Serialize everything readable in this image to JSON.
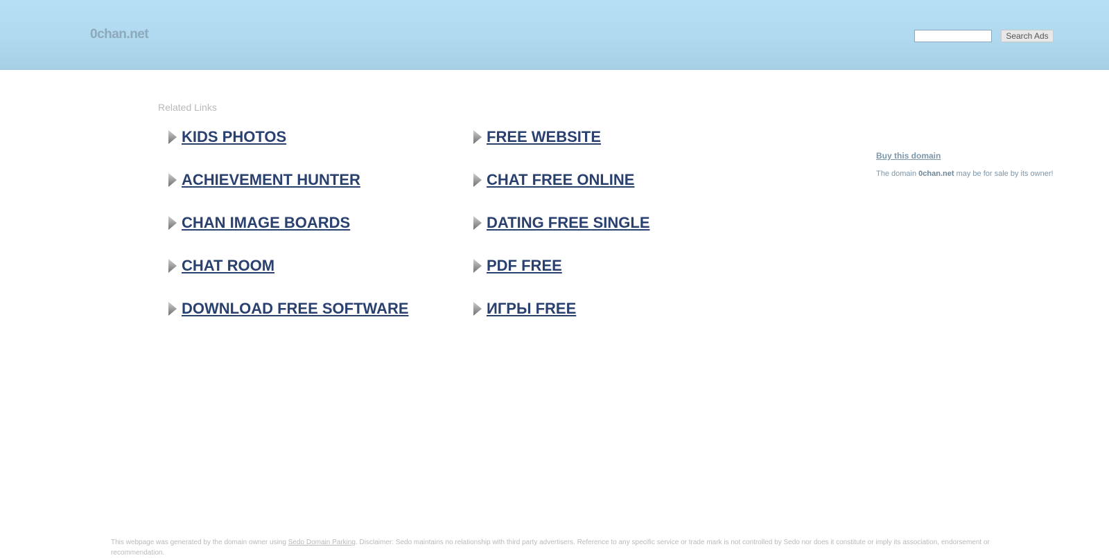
{
  "header": {
    "site_name": "0chan.net",
    "search_placeholder": "",
    "search_value": "",
    "search_button_label": "Search Ads"
  },
  "related": {
    "title": "Related Links",
    "left_column": [
      "KIDS PHOTOS",
      "ACHIEVEMENT HUNTER",
      "CHAN IMAGE BOARDS",
      "CHAT ROOM",
      "DOWNLOAD FREE SOFTWARE"
    ],
    "right_column": [
      "FREE WEBSITE",
      "CHAT FREE ONLINE",
      "DATING FREE SINGLE",
      "PDF FREE",
      "ИГРЫ FREE"
    ]
  },
  "sidebar": {
    "buy_label": "Buy this domain",
    "sale_prefix": "The domain ",
    "sale_domain": "0chan.net",
    "sale_suffix": " may be for sale by its owner!"
  },
  "footer": {
    "prefix": "This webpage was generated by the domain owner using ",
    "link": "Sedo Domain Parking",
    "suffix": ". Disclaimer: Sedo maintains no relationship with third party advertisers. Reference to any specific service or trade mark is not controlled by Sedo nor does it constitute or imply its association, endorsement or recommendation."
  },
  "colors": {
    "header_bg": "#b0d9ef",
    "link_color": "#2a4170",
    "muted_text": "#7c96aa"
  }
}
